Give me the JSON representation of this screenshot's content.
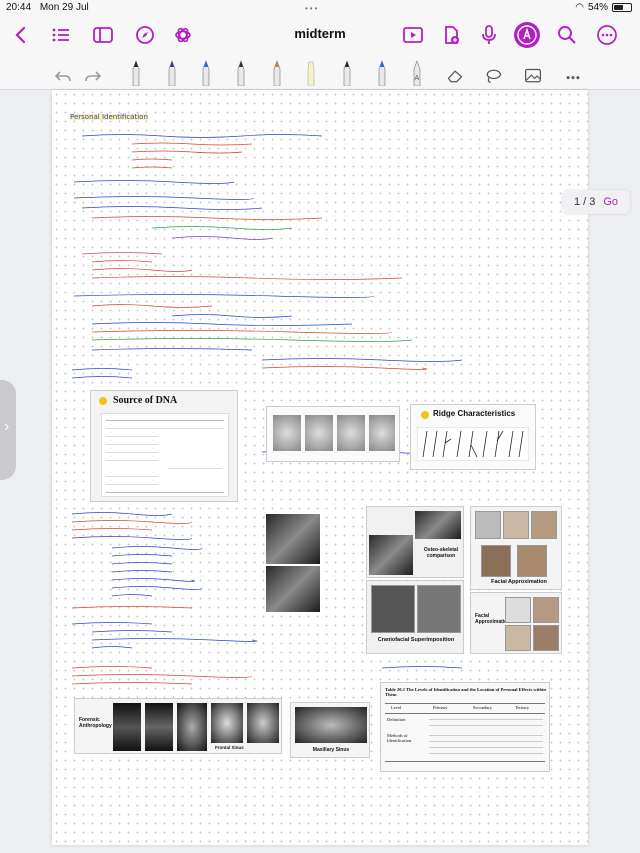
{
  "status": {
    "time": "20:44",
    "date": "Mon 29 Jul",
    "battery": "54%",
    "battery_level": 0.54
  },
  "header": {
    "title": "midterm"
  },
  "pager": {
    "indicator": "1 / 3",
    "go": "Go"
  },
  "colors": {
    "accent": "#b31fc2",
    "ink_blue": "#2c3fd6",
    "ink_red": "#d2432f",
    "ink_green": "#2f9d4a"
  },
  "icons": {
    "nav": [
      "back-icon",
      "list-icon",
      "sidebar-icon",
      "compass-icon",
      "openai-icon"
    ],
    "right": [
      "present-icon",
      "add-page-icon",
      "microphone-icon",
      "pen-mode-icon",
      "search-icon",
      "more-icon"
    ],
    "tools": [
      "undo-icon",
      "redo-icon",
      "fountain-pen-icon",
      "ballpoint-pen-icon",
      "brush-pen-icon",
      "pencil-icon",
      "marker-icon",
      "highlighter-icon",
      "pen-icon",
      "pen-icon",
      "text-pen-icon",
      "eraser-icon",
      "lasso-icon",
      "image-icon",
      "more-horizontal-icon"
    ]
  },
  "note": {
    "heading": "Personal Identification",
    "sections": {
      "forensic_odontology": "Forensic Odontology",
      "forensic_anthropology": "Forensic Anthropology",
      "evidences": "Evidences for Personal Identification",
      "level": "Level",
      "skeletal": "Skeletal characteristic comparison",
      "fingerprint": "Fingerprint",
      "level_of_id": "Level of Identification"
    }
  },
  "figures": {
    "dna_title": "Source of DNA",
    "ridge_title": "Ridge Characteristics",
    "osteo": "Osteo-skeletal comparison",
    "facial_approx": "Facial Approximation",
    "facial_approx2": "Facial Approximation",
    "craniofacial": "Craniofacial Superimposition",
    "forensic_anthro": "Forensic Anthropology",
    "frontal": "Frontal Sinus",
    "maxillary": "Maxillary Sinus",
    "table_title": "Table 20.1  The Levels of Identification and the Location of Personal Effects within Them",
    "table_cols": [
      "Level",
      "Primary",
      "Secondary",
      "Tertiary"
    ],
    "table_rows": [
      "Definition",
      "Methods of Identification"
    ]
  }
}
